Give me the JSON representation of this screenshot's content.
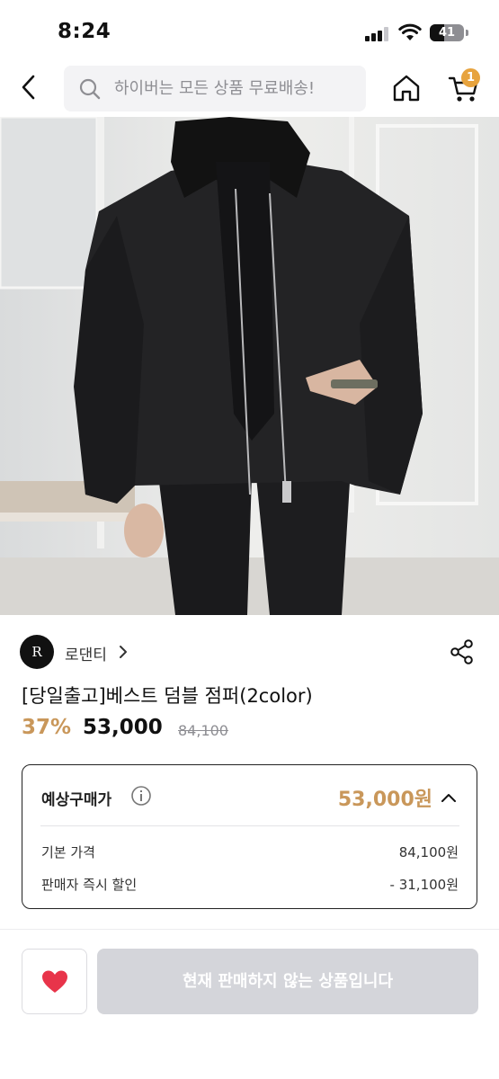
{
  "status_bar": {
    "time": "8:24",
    "battery": "41",
    "battery_level": 0.41
  },
  "top_nav": {
    "search_placeholder": "하이버는 모든 상품 무료배송!",
    "cart_count": "1",
    "icons": [
      "back-icon",
      "search-icon",
      "home-icon",
      "cart-icon"
    ]
  },
  "product": {
    "image_description_icon": "product-photo",
    "brand": {
      "logo_text": "R",
      "name": "로댄티"
    },
    "title": "[당일출고]베스트 덤블 점퍼(2color)",
    "discount": "37%",
    "price": "53,000",
    "original_price": "84,100"
  },
  "estimated_price": {
    "label": "예상구매가",
    "value": "53,000원",
    "rows": [
      {
        "label": "기본 가격",
        "value": "84,100원"
      },
      {
        "label": "판매자 즉시 할인",
        "value": "- 31,100원"
      }
    ]
  },
  "bottom_bar": {
    "buy_label": "현재 판매하지 않는 상품입니다"
  },
  "colors": {
    "accent": "#c9975a",
    "badge": "#e7a33e",
    "heart": "#e8344a",
    "disabled_button": "#d4d5da"
  }
}
